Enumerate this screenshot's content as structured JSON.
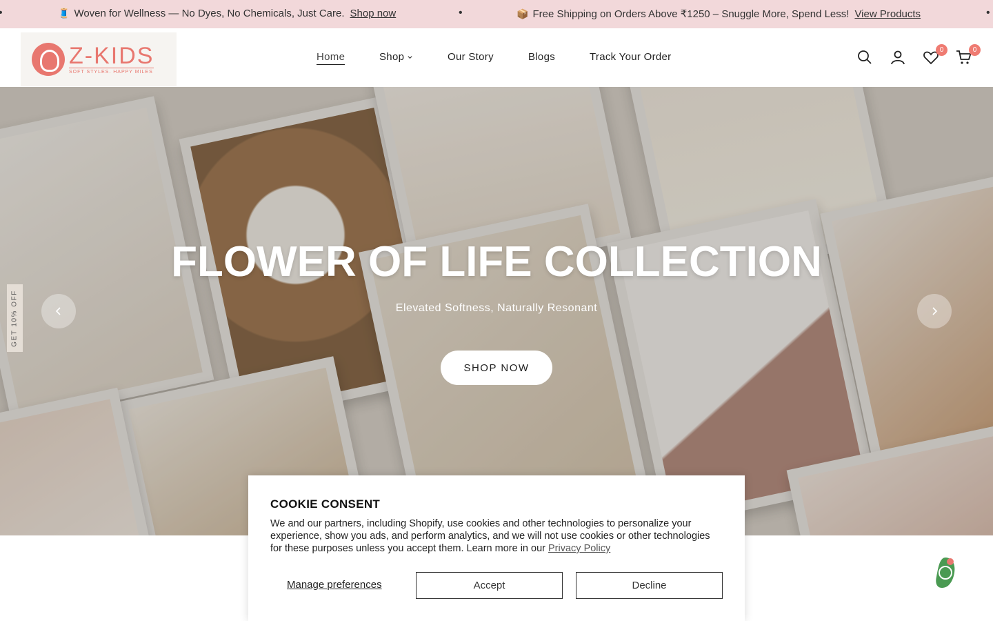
{
  "announcement": {
    "items": [
      {
        "icon": "🧵",
        "text": "Woven for Wellness — No Dyes, No Chemicals, Just Care.",
        "link": "Shop now"
      },
      {
        "icon": "📦",
        "text": "Free Shipping on Orders Above ₹1250 – Snuggle More, Spend Less!",
        "link": "View Products"
      }
    ],
    "separator": "•"
  },
  "logo": {
    "name": "Z-KIDS",
    "tagline": "SOFT STYLES. HAPPY MILES"
  },
  "nav": {
    "home": "Home",
    "shop": "Shop",
    "our_story": "Our Story",
    "blogs": "Blogs",
    "track": "Track Your Order"
  },
  "header_icons": {
    "search": "search-icon",
    "account": "user-icon",
    "wishlist": "heart-icon",
    "cart": "cart-icon",
    "wishlist_count": "0",
    "cart_count": "0"
  },
  "hero": {
    "title": "FLOWER OF LIFE COLLECTION",
    "subtitle": "Elevated Softness, Naturally Resonant",
    "button": "SHOP NOW"
  },
  "side_tab": "GET 10% OFF",
  "cookie": {
    "title": "COOKIE CONSENT",
    "body": "We and our partners, including Shopify, use cookies and other technologies to personalize your experience, show you ads, and perform analytics, and we will not use cookies or other technologies for these purposes unless you accept them. Learn more in our ",
    "privacy_link": "Privacy Policy",
    "manage": "Manage preferences",
    "accept": "Accept",
    "decline": "Decline"
  },
  "colors": {
    "accent": "#e8776f",
    "announce_bg": "#f2d8da",
    "badge": "#ef7b72"
  }
}
